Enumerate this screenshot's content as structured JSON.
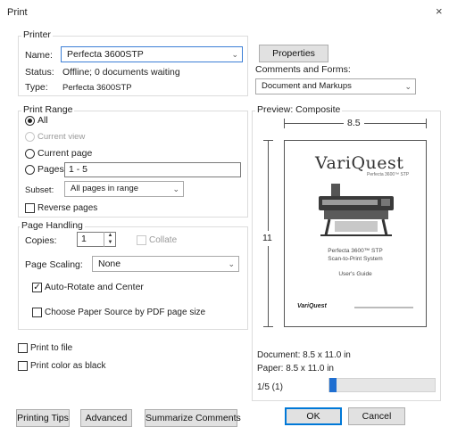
{
  "window": {
    "title": "Print",
    "close_glyph": "×"
  },
  "printer": {
    "group_label": "Printer",
    "name_label": "Name:",
    "name_value": "Perfecta 3600STP",
    "status_label": "Status:",
    "status_value": "Offline; 0 documents waiting",
    "type_label": "Type:",
    "type_value": "Perfecta 3600STP",
    "properties_button": "Properties",
    "comments_label": "Comments and Forms:",
    "comments_value": "Document and Markups"
  },
  "print_range": {
    "group_label": "Print Range",
    "all": "All",
    "current_view": "Current view",
    "current_page": "Current page",
    "pages": "Pages",
    "pages_value": "1 - 5",
    "subset_label": "Subset:",
    "subset_value": "All pages in range",
    "reverse_pages": "Reverse pages"
  },
  "page_handling": {
    "group_label": "Page Handling",
    "copies_label": "Copies:",
    "copies_value": "1",
    "collate": "Collate",
    "page_scaling_label": "Page Scaling:",
    "page_scaling_value": "None",
    "auto_rotate": "Auto-Rotate and Center",
    "choose_paper_source": "Choose Paper Source by PDF page size"
  },
  "options": {
    "print_to_file": "Print to file",
    "print_color_as_black": "Print color as black"
  },
  "preview": {
    "group_label": "Preview: Composite",
    "width_label": "8.5",
    "height_label": "11",
    "doc_brand": "VariQuest",
    "doc_subtitle": "Perfecta 3600™ STP",
    "doc_line1": "Perfecta 3600™ STP",
    "doc_line2": "Scan-to-Print System",
    "doc_line3": "User's Guide",
    "doc_footer_logo": "VariQuest",
    "document_size": "Document: 8.5 x 11.0 in",
    "paper_size": "Paper: 8.5 x 11.0 in",
    "page_indicator": "1/5 (1)",
    "slider_position": 0.0
  },
  "footer": {
    "printing_tips": "Printing Tips",
    "advanced": "Advanced",
    "summarize_comments": "Summarize Comments",
    "ok": "OK",
    "cancel": "Cancel"
  },
  "colors": {
    "accent": "#0078d7",
    "slider_thumb": "#1f6fd1"
  },
  "icons": [
    "close-icon",
    "chevron-down-icon",
    "spin-up-icon",
    "spin-down-icon",
    "printer-illustration-icon"
  ]
}
